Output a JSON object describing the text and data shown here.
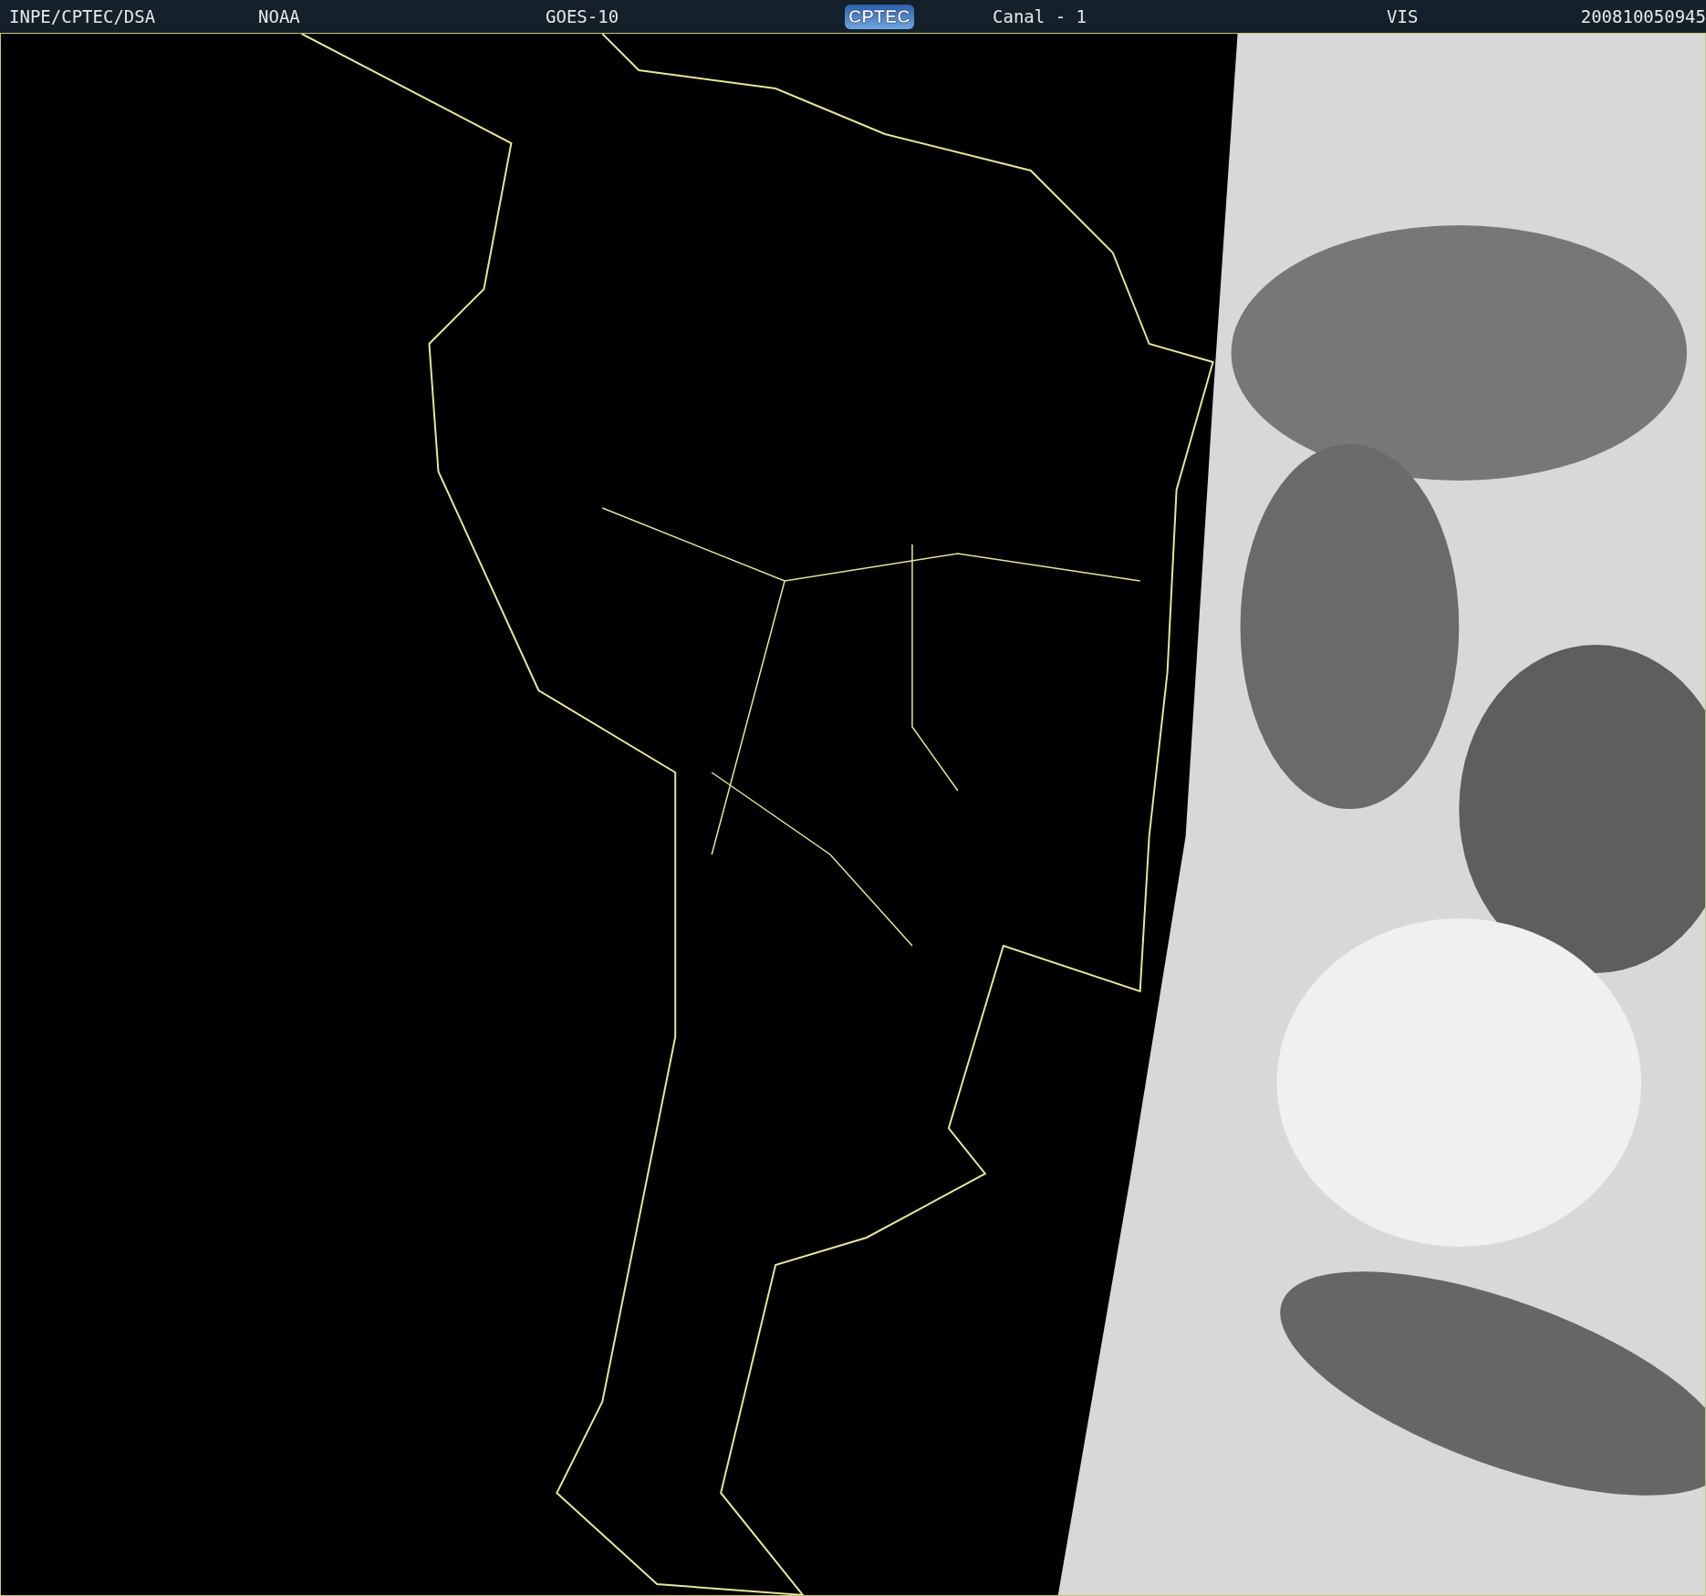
{
  "header": {
    "source": "INPE/CPTEC/DSA",
    "agency": "NOAA",
    "satellite": "GOES-10",
    "logo": "CPTEC",
    "channel": "Canal - 1",
    "band": "VIS",
    "timestamp": "200810050945"
  }
}
